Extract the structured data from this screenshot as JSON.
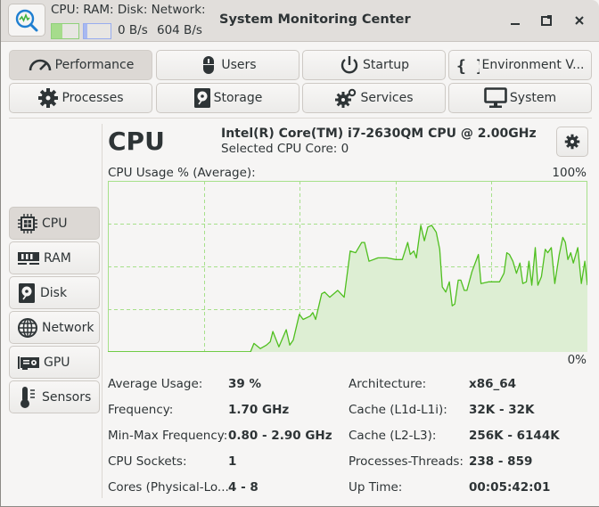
{
  "titlebar": {
    "app_title": "System Monitoring Center",
    "monitor_labels": "CPU: RAM: Disk: Network:",
    "cpu_bar_fill_percent": 39,
    "ram_bar_fill_percent": 12,
    "disk_rate": "0 B/s",
    "network_rate": "604 B/s",
    "minimize_icon": "minimize-icon",
    "restore_icon": "restore-icon",
    "close_icon": "close-icon"
  },
  "tabs": [
    {
      "label": "Performance",
      "icon": "speedometer-icon",
      "active": true
    },
    {
      "label": "Users",
      "icon": "mouse-icon",
      "active": false
    },
    {
      "label": "Startup",
      "icon": "power-icon",
      "active": false
    },
    {
      "label": "Environment V...",
      "icon": "braces-icon",
      "active": false
    },
    {
      "label": "Processes",
      "icon": "gear-icon",
      "active": false
    },
    {
      "label": "Storage",
      "icon": "harddisk-icon",
      "active": false
    },
    {
      "label": "Services",
      "icon": "gears-icon",
      "active": false
    },
    {
      "label": "System",
      "icon": "monitor-icon",
      "active": false
    }
  ],
  "sidebar": {
    "items": [
      {
        "label": "CPU",
        "icon": "cpu-chip-icon",
        "active": true
      },
      {
        "label": "RAM",
        "icon": "ram-icon",
        "active": false
      },
      {
        "label": "Disk",
        "icon": "harddisk-icon",
        "active": false
      },
      {
        "label": "Network",
        "icon": "globe-icon",
        "active": false
      },
      {
        "label": "GPU",
        "icon": "gpu-card-icon",
        "active": false
      },
      {
        "label": "Sensors",
        "icon": "thermometer-icon",
        "active": false
      }
    ]
  },
  "main": {
    "heading": "CPU",
    "model": "Intel(R) Core(TM) i7-2630QM CPU @ 2.00GHz",
    "selected_core": "Selected CPU Core: 0",
    "settings_icon": "gear-icon",
    "chart_label": "CPU Usage % (Average):",
    "max_label": "100%",
    "min_label": "0%"
  },
  "stats": {
    "left": [
      {
        "label": "Average Usage:",
        "value": "39 %"
      },
      {
        "label": "Frequency:",
        "value": "1.70 GHz"
      },
      {
        "label": "Min-Max Frequency:",
        "value": "0.80 - 2.90 GHz"
      },
      {
        "label": "CPU Sockets:",
        "value": "1"
      },
      {
        "label": "Cores (Physical-Lo...",
        "value": "4 - 8"
      }
    ],
    "right": [
      {
        "label": "Architecture:",
        "value": "x86_64"
      },
      {
        "label": "Cache (L1d-L1i):",
        "value": "32K - 32K"
      },
      {
        "label": "Cache (L2-L3):",
        "value": "256K - 6144K"
      },
      {
        "label": "Processes-Threads:",
        "value": "238 - 859"
      },
      {
        "label": "Up Time:",
        "value": "00:05:42:01"
      }
    ]
  },
  "colors": {
    "chart_line": "#4fbf1f",
    "chart_fill": "#ddeed3",
    "chart_grid": "#a6e08a",
    "chart_bg": "#f6f5f4"
  },
  "chart_data": {
    "type": "area",
    "title": "CPU Usage % (Average):",
    "xlabel": "",
    "ylabel": "CPU Usage %",
    "ylim": [
      0,
      100
    ],
    "xlim": [
      0,
      150
    ],
    "grid": true,
    "grid_columns": 5,
    "grid_rows": 4,
    "legend": "none",
    "points": [
      [
        0,
        0
      ],
      [
        44.6,
        0
      ],
      [
        45.7,
        5
      ],
      [
        47.7,
        2
      ],
      [
        49.6,
        4
      ],
      [
        50.8,
        6
      ],
      [
        51.6,
        12
      ],
      [
        53.5,
        3
      ],
      [
        55.8,
        13
      ],
      [
        56.9,
        4
      ],
      [
        58.0,
        7
      ],
      [
        59.9,
        22
      ],
      [
        61.1,
        19
      ],
      [
        63.3,
        21
      ],
      [
        64.1,
        23
      ],
      [
        65.0,
        19
      ],
      [
        66.9,
        34
      ],
      [
        67.8,
        35
      ],
      [
        69.4,
        32
      ],
      [
        71.9,
        36
      ],
      [
        73.9,
        32
      ],
      [
        75.8,
        59
      ],
      [
        77.5,
        58
      ],
      [
        79.4,
        64
      ],
      [
        80.3,
        64
      ],
      [
        81.7,
        53
      ],
      [
        84.5,
        55
      ],
      [
        87.3,
        55
      ],
      [
        90.1,
        54
      ],
      [
        91.5,
        54
      ],
      [
        92.1,
        54
      ],
      [
        93.8,
        64
      ],
      [
        94.6,
        57
      ],
      [
        95.7,
        59
      ],
      [
        96.5,
        55
      ],
      [
        97.9,
        74
      ],
      [
        99.0,
        65
      ],
      [
        100.1,
        73
      ],
      [
        101.3,
        74
      ],
      [
        102.7,
        70
      ],
      [
        103.8,
        60
      ],
      [
        104.6,
        38
      ],
      [
        105.7,
        35
      ],
      [
        106.8,
        41
      ],
      [
        107.7,
        27
      ],
      [
        108.5,
        28
      ],
      [
        109.6,
        42
      ],
      [
        110.4,
        42
      ],
      [
        111.5,
        36
      ],
      [
        112.3,
        36
      ],
      [
        113.9,
        47
      ],
      [
        115.9,
        57
      ],
      [
        116.7,
        40
      ],
      [
        119.2,
        41
      ],
      [
        120.6,
        41
      ],
      [
        122.5,
        41
      ],
      [
        123.9,
        46
      ],
      [
        124.8,
        58
      ],
      [
        125.6,
        57
      ],
      [
        126.7,
        53
      ],
      [
        127.8,
        46
      ],
      [
        128.9,
        52
      ],
      [
        129.8,
        40
      ],
      [
        130.9,
        41
      ],
      [
        131.7,
        53
      ],
      [
        132.6,
        39
      ],
      [
        133.7,
        61
      ],
      [
        134.5,
        39
      ],
      [
        135.6,
        44
      ],
      [
        136.8,
        60
      ],
      [
        137.6,
        58
      ],
      [
        138.7,
        61
      ],
      [
        139.8,
        40
      ],
      [
        141.2,
        57
      ],
      [
        142.3,
        67
      ],
      [
        143.1,
        64
      ],
      [
        143.9,
        54
      ],
      [
        144.8,
        58
      ],
      [
        145.6,
        52
      ],
      [
        147.0,
        61
      ],
      [
        148.1,
        40
      ],
      [
        149.2,
        53
      ],
      [
        150.0,
        39
      ]
    ]
  }
}
